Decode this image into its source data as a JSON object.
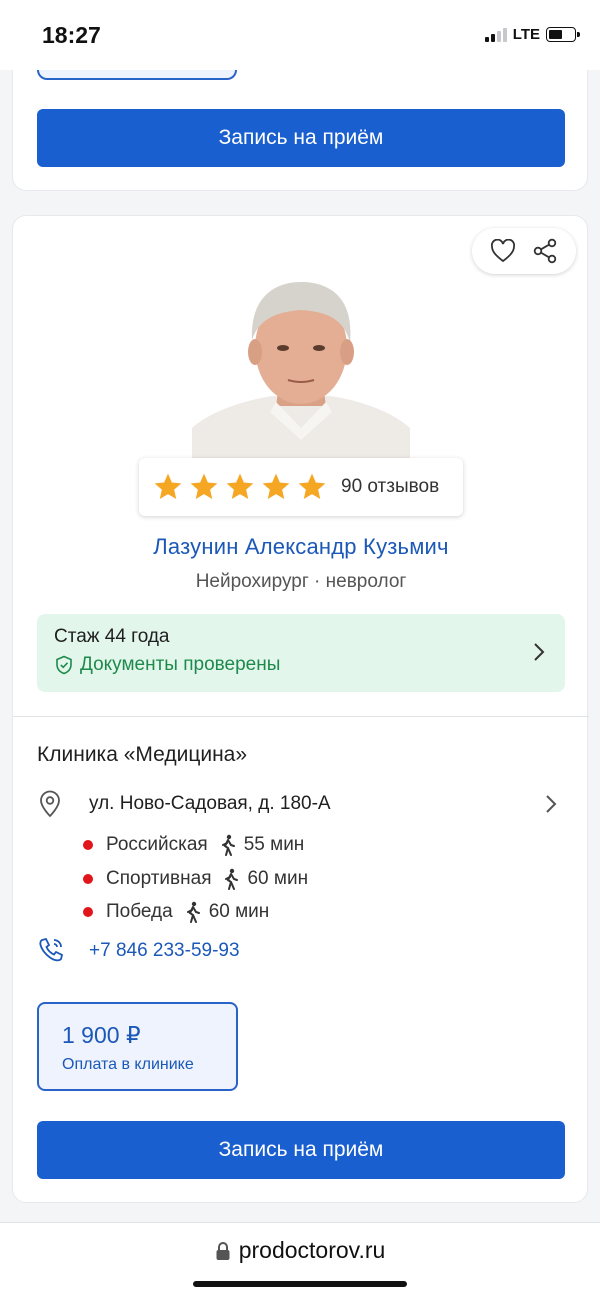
{
  "status_bar": {
    "time": "18:27",
    "network": "LTE",
    "signal_bars_active": 2,
    "battery_level": 0.55
  },
  "top_card": {
    "book_button": "Запись на приём"
  },
  "doctor": {
    "name": "Лазунин Александр Кузьмич",
    "specialty": "Нейрохирург · невролог",
    "rating_stars": 5,
    "reviews": "90 отзывов",
    "experience": "Стаж 44 года",
    "verified": "Документы проверены"
  },
  "actions": {
    "favorite_icon": "heart-icon",
    "share_icon": "share-icon"
  },
  "clinic": {
    "name": "Клиника «Медицина»",
    "address": "ул. Ново-Садовая, д. 180-А",
    "metro": [
      {
        "station": "Российская",
        "walk": "55 мин"
      },
      {
        "station": "Спортивная",
        "walk": "60 мин"
      },
      {
        "station": "Победа",
        "walk": "60 мин"
      }
    ],
    "phone": "+7 846 233-59-93"
  },
  "price": {
    "amount": "1 900 ₽",
    "note": "Оплата в клинике"
  },
  "book_button": "Запись на приём",
  "browser": {
    "url": "prodoctorov.ru"
  },
  "colors": {
    "primary": "#1a5fcf",
    "link": "#1b58b8",
    "verified_green": "#1e8a4c",
    "star": "#f5a623",
    "metro_red": "#e0161c"
  }
}
